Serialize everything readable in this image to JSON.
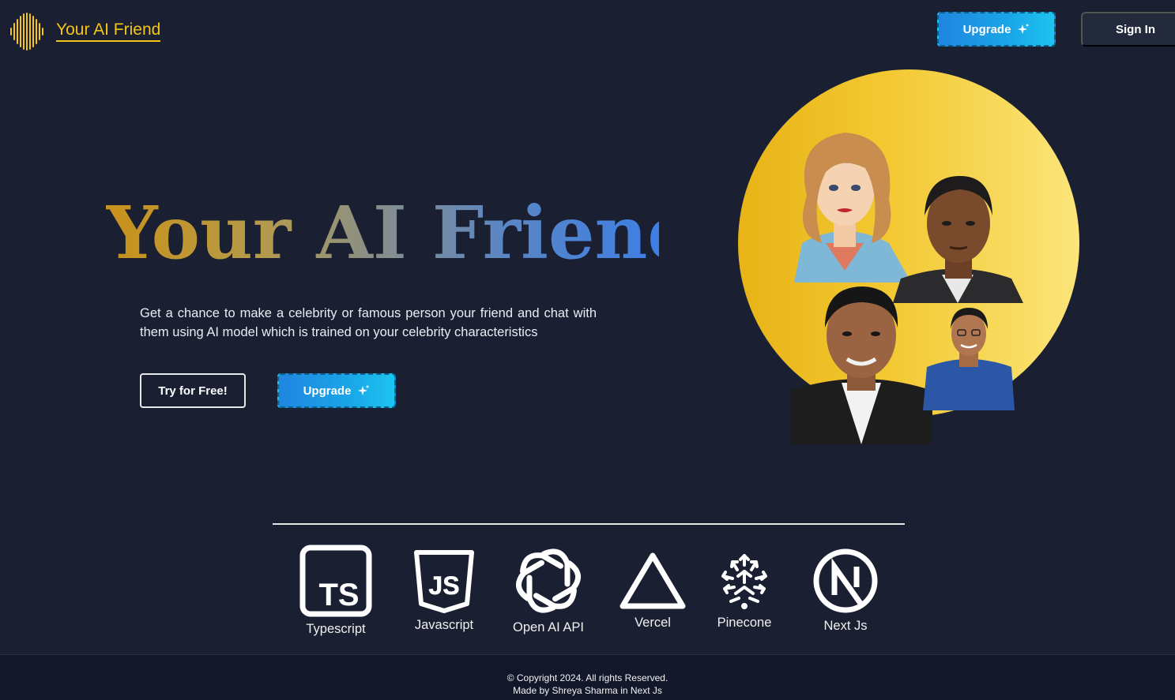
{
  "header": {
    "brand": "Your AI Friend",
    "logo_icon": "sound-wave-icon",
    "upgrade_label": "Upgrade",
    "signin_label": "Sign In"
  },
  "hero": {
    "title": "Your AI Friend",
    "description": "Get a chance to make a celebrity or famous person your friend and chat with them using AI model which is trained on your celebrity characteristics",
    "try_label": "Try for Free!",
    "upgrade_label": "Upgrade"
  },
  "tech_stack": [
    {
      "label": "Typescript",
      "icon": "typescript-icon"
    },
    {
      "label": "Javascript",
      "icon": "javascript-icon"
    },
    {
      "label": "Open AI API",
      "icon": "openai-icon"
    },
    {
      "label": "Vercel",
      "icon": "vercel-icon"
    },
    {
      "label": "Pinecone",
      "icon": "pinecone-icon"
    },
    {
      "label": "Next Js",
      "icon": "nextjs-icon"
    }
  ],
  "footer": {
    "copyright": "© Copyright 2024. All rights Reserved.",
    "credit": "Made by Shreya Sharma in Next Js"
  },
  "colors": {
    "background": "#1a2032",
    "brand_yellow": "#f5c518",
    "upgrade_gradient_start": "#1f86e0",
    "upgrade_gradient_end": "#1cc4ef",
    "circle_yellow": "#f3c933",
    "footer_bg": "#121829"
  }
}
